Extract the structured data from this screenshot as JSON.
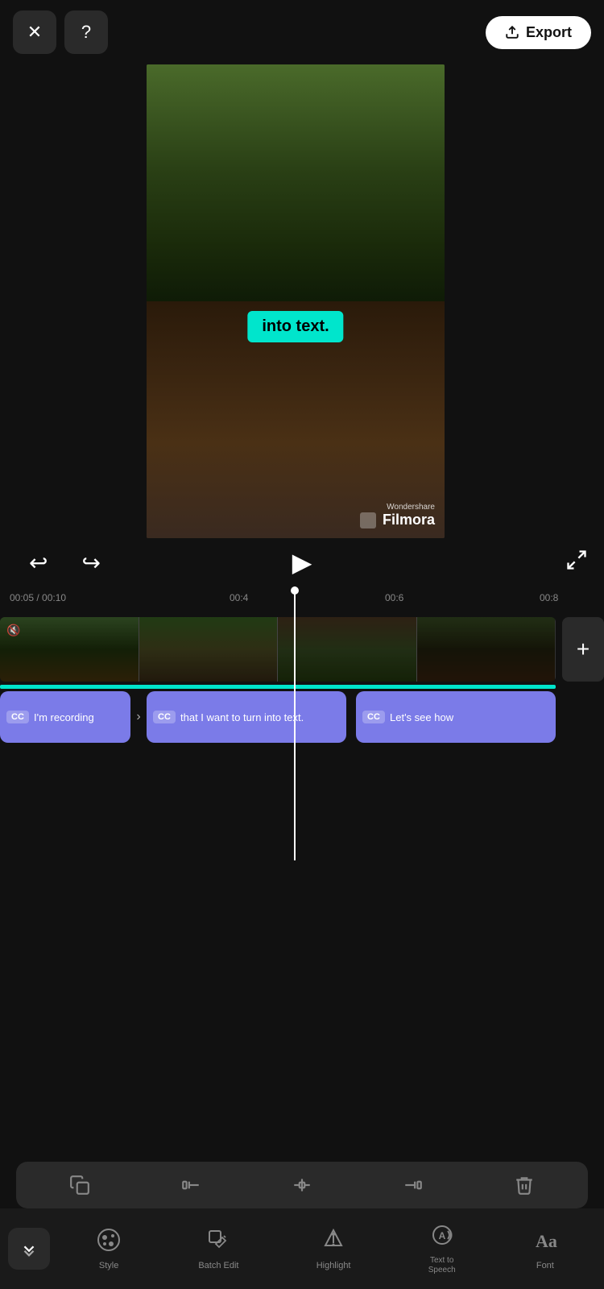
{
  "topBar": {
    "closeLabel": "✕",
    "helpLabel": "?",
    "exportLabel": "Export"
  },
  "videoPreview": {
    "captionText": "into text.",
    "watermarkBrand": "Wondershare",
    "watermarkName": "Filmora"
  },
  "playback": {
    "undoSymbol": "↩",
    "redoSymbol": "↪",
    "playSymbol": "▶",
    "fullscreenSymbol": "⛶",
    "currentTime": "00:05",
    "totalTime": "00:10",
    "marker1": "00:4",
    "marker2": "00:6",
    "marker3": "00:8"
  },
  "timeline": {
    "addBtnLabel": "+",
    "clips": [
      {
        "cc": "CC",
        "text": "I'm recording"
      },
      {
        "cc": "CC",
        "text": "that I want to turn into text."
      },
      {
        "cc": "CC",
        "text": "Let's see how"
      }
    ]
  },
  "bottomToolbar": {
    "tools": [
      "duplicate",
      "trim-start",
      "split",
      "trim-end",
      "delete"
    ]
  },
  "bottomNav": {
    "collapseLabel": "❮❮",
    "items": [
      {
        "id": "style",
        "label": "Style",
        "icon": "style"
      },
      {
        "id": "batch-edit",
        "label": "Batch Edit",
        "icon": "batch-edit"
      },
      {
        "id": "highlight",
        "label": "Highlight",
        "icon": "highlight"
      },
      {
        "id": "text-to-speech",
        "label": "Text to Speech",
        "icon": "tts"
      },
      {
        "id": "font",
        "label": "Font",
        "icon": "font"
      }
    ]
  }
}
